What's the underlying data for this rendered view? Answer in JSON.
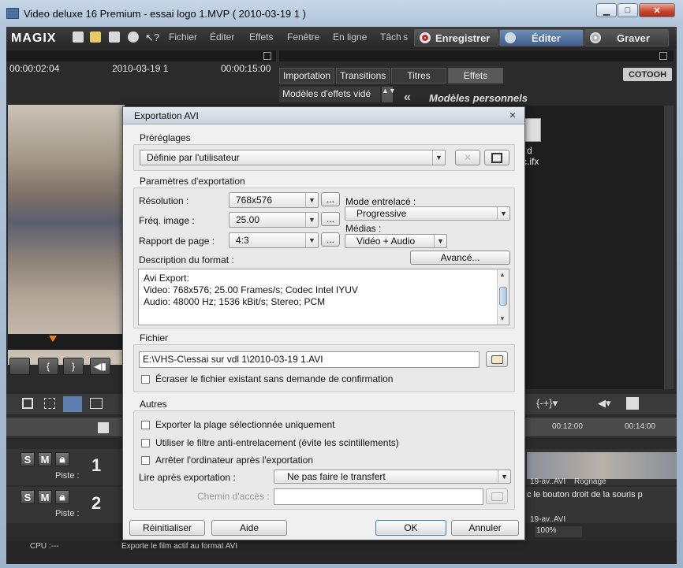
{
  "window": {
    "title": "Video deluxe 16 Premium - essai logo 1.MVP ( 2010-03-19 1 )"
  },
  "app": {
    "logo": "MAGIX",
    "menu": [
      "Fichier",
      "Éditer",
      "Effets",
      "Fenêtre",
      "En ligne",
      "Tâch s"
    ],
    "modes": {
      "record": "Enregistrer",
      "edit": "Éditer",
      "burn": "Graver"
    }
  },
  "preview": {
    "timecode_left": "00:00:02:04",
    "date": "2010-03-19 1",
    "timecode_right": "00:00:15:00"
  },
  "media_pool": {
    "tabs": [
      "Importation",
      "Transitions",
      "Titres",
      "Effets"
    ],
    "active_tab": "Effets",
    "brand": "COTOOH",
    "effects_dropdown": "Modèles d'effets vidé",
    "custom_templates": "Modèles personnels",
    "file_partial_1": "d",
    "file_partial_2": "c.ifx"
  },
  "timeline": {
    "tracks": [
      {
        "number": "1",
        "label": "Piste :"
      },
      {
        "number": "2",
        "label": "Piste :"
      }
    ],
    "ruler": [
      "00:12:00",
      "00:14:00"
    ],
    "clip_text_1": "19-av..AVI",
    "clip_text_2": "Rognage",
    "clip_text_3": "c le bouton droit de la souris p",
    "clip_text_4": "19-av..AVI",
    "zoom": "100%"
  },
  "status": {
    "cpu": "CPU :---",
    "hint": "Exporte le film actif au format AVI"
  },
  "dialog": {
    "title": "Exportation AVI",
    "presets": {
      "label": "Préréglages",
      "value": "Définie par l'utilisateur"
    },
    "export_params": {
      "label": "Paramètres d'exportation",
      "resolution_label": "Résolution :",
      "resolution": "768x576",
      "framerate_label": "Fréq. image :",
      "framerate": "25.00",
      "ratio_label": "Rapport de page :",
      "ratio": "4:3",
      "interlace_label": "Mode entrelacé :",
      "interlace": "Progressive",
      "media_label": "Médias :",
      "media": "Vidéo + Audio",
      "advanced": "Avancé...",
      "format_desc_label": "Description du format :",
      "format_desc": [
        "Avi Export:",
        "Video: 768x576; 25.00 Frames/s; Codec Intel IYUV",
        "Audio: 48000 Hz; 1536 kBit/s; Stereo; PCM"
      ],
      "dots": "..."
    },
    "file": {
      "label": "Fichier",
      "path": "E:\\VHS-C\\essai sur vdl 1\\2010-03-19 1.AVI",
      "overwrite": "Écraser le fichier existant sans demande de confirmation"
    },
    "others": {
      "label": "Autres",
      "opt1": "Exporter la plage sélectionnée uniquement",
      "opt2": "Utiliser le filtre anti-entrelacement (évite les scintillements)",
      "opt3": "Arrêter l'ordinateur après l'exportation",
      "play_after_label": "Lire après exportation :",
      "play_after": "Ne pas faire le transfert",
      "path_label": "Chemin d'accès :"
    },
    "buttons": {
      "reset": "Réinitialiser",
      "help": "Aide",
      "ok": "OK",
      "cancel": "Annuler"
    }
  }
}
